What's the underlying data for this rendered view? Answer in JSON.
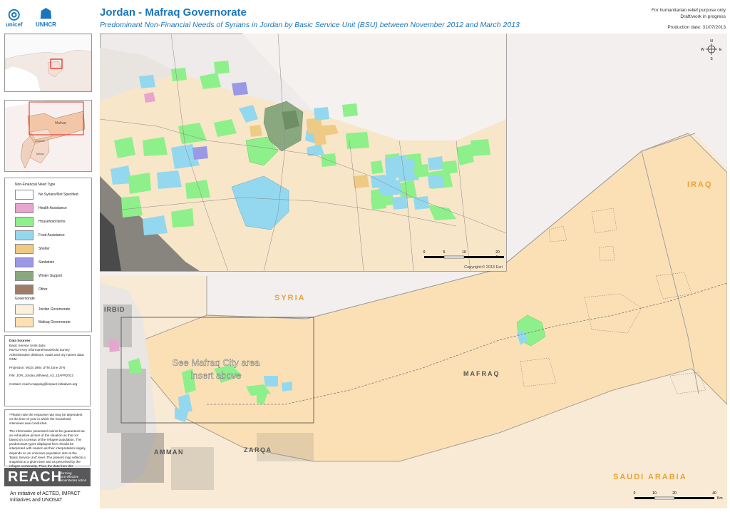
{
  "header": {
    "unicef": "unicef",
    "unhcr": "UNHCR",
    "title": "Jordan - Mafraq Governorate",
    "subtitle": "Predominant Non-Financial Needs of Syrians in Jordan by Basic Service Unit (BSU) between November 2012 and March 2013",
    "relief_line1": "For humanitarian relief purpose only",
    "relief_line2": "Draft/work in progress",
    "production_date": "Production date: 31/07/2013"
  },
  "legend": {
    "title": "Non-Financial Need Type",
    "items": [
      {
        "label": "No Syrians/Not Specified",
        "color": "#ffffff"
      },
      {
        "label": "Health Assistance",
        "color": "#e6a6cf"
      },
      {
        "label": "Household Items",
        "color": "#8ef08a"
      },
      {
        "label": "Food Assistance",
        "color": "#93d8ef"
      },
      {
        "label": "Shelter",
        "color": "#efca84"
      },
      {
        "label": "Sanitation",
        "color": "#9b98e6"
      },
      {
        "label": "Winter Support",
        "color": "#8aa880"
      },
      {
        "label": "Other",
        "color": "#a07b68"
      }
    ],
    "gov_title": "Governorate",
    "gov_items": [
      {
        "label": "Jordan Governorate",
        "color": "#fbf1da"
      },
      {
        "label": "Mafraq Governorate",
        "color": "#fbe0b6"
      }
    ]
  },
  "sources": {
    "l1": "Data Sources:",
    "l2": "Basic Service Units data:",
    "l3": "REACH Key Informant/Household Survey",
    "l4": "Administrative divisions, roads and city names data:",
    "l5": "OSM",
    "l6": "Projection: WGS 1984 UTM Zone 37N",
    "l7": "File: JOR_Jordan_MfNeed_A3_13APR2012",
    "l8": "Contact: reach.mapping@impact-initiatives.org"
  },
  "notes": {
    "p1": "*Please note the response rate may be dependent on the time of year in which the household interviews was conducted.",
    "p2": "The information presented cannot be guaranteed as an exhaustive picture of the situation as this not based on a census of the refugee population. The predominant types displayed here should be interpreted with caution as their interpretation largely depends on an unknown population size at the 'Basic Service Unit' level. The present map reflects a snapshot at a given time and as perceived by the refugee community. Thus, the data from this assessment can be used to discover characteristic patterns but is not legally valid for case based decisions."
  },
  "branding": {
    "reach": "REACH",
    "tag1": "informing",
    "tag2": "more effective",
    "tag3": "humanitarian action",
    "initiative1": "An initiative of ACTED, IMPACT",
    "initiative2": "Initiatives and UNOSAT"
  },
  "map": {
    "labels": {
      "iraq": "IRAQ",
      "syria": "SYRIA",
      "mafraq": "MAFRAQ",
      "saudi": "SAUDI ARABIA",
      "amman": "AMMAN",
      "zarqa": "ZARQA",
      "irbid": "IRBID",
      "insert1": "See Mafraq City area",
      "insert2": "insert above"
    },
    "inset_copyright": "Copyright:© 2013 Esri",
    "inset_scale": [
      "0",
      "5",
      "10",
      "20"
    ],
    "inset_unit": "Km",
    "main_scale": [
      "0",
      "10",
      "20",
      "40"
    ],
    "main_unit": "Km",
    "north": {
      "n": "N",
      "s": "S",
      "e": "E",
      "w": "W"
    }
  },
  "locator": {
    "country": "Mafraq",
    "gov_small": "Amman",
    "south": "Ma'an"
  }
}
